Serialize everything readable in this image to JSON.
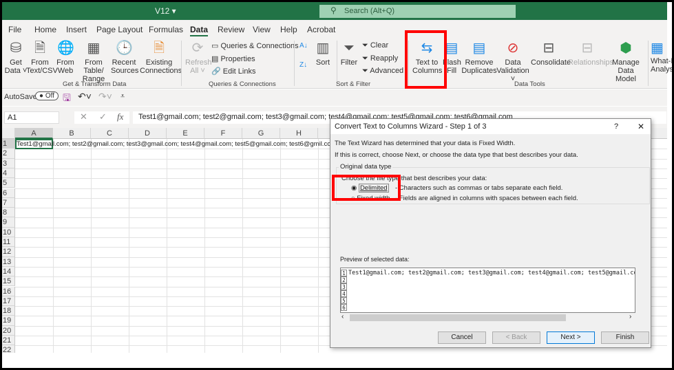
{
  "title_bar": {
    "file_name": "V12 ▾",
    "search_placeholder": "Search (Alt+Q)"
  },
  "tabs": [
    "File",
    "Home",
    "Insert",
    "Page Layout",
    "Formulas",
    "Data",
    "Review",
    "View",
    "Help",
    "Acrobat"
  ],
  "active_tab": "Data",
  "ribbon": {
    "get_transform": {
      "items": [
        [
          "Get",
          "Data ˅"
        ],
        [
          "From",
          "Text/CSV"
        ],
        [
          "From",
          "Web"
        ],
        [
          "From Table/",
          "Range"
        ],
        [
          "Recent",
          "Sources"
        ],
        [
          "Existing",
          "Connections"
        ]
      ],
      "label": "Get & Transform Data"
    },
    "queries": {
      "refresh": [
        "Refresh",
        "All ˅"
      ],
      "items": [
        "Queries & Connections",
        "Properties",
        "Edit Links"
      ],
      "label": "Queries & Connections"
    },
    "sort_filter": {
      "sort": "Sort",
      "filter": "Filter",
      "clear": "Clear",
      "reapply": "Reapply",
      "advanced": "Advanced",
      "label": "Sort & Filter"
    },
    "data_tools": {
      "items": [
        [
          "Text to",
          "Columns"
        ],
        [
          "Flash",
          "Fill"
        ],
        [
          "Remove",
          "Duplicates"
        ],
        [
          "Data",
          "Validation ˅"
        ],
        [
          "Consolidate",
          ""
        ],
        [
          "Relationships",
          ""
        ],
        [
          "Manage",
          "Data Model"
        ]
      ],
      "label": "Data Tools"
    },
    "what_if": [
      "What-If",
      "Analysis"
    ],
    "highlight_color": "#ff0000"
  },
  "qat": {
    "autosave": "AutoSave",
    "toggle": "Off"
  },
  "formula_bar": {
    "name_box": "A1",
    "fx": "fx",
    "value": "Test1@gmail.com; test2@gmail.com; test3@gmail.com; test4@gmail.com; test5@gmail.com; test6@gmail.com"
  },
  "sheet": {
    "columns": [
      "A",
      "B",
      "C",
      "D",
      "E",
      "F",
      "G",
      "H"
    ],
    "rows": [
      "1",
      "2",
      "3",
      "4",
      "5",
      "6",
      "7",
      "8",
      "9",
      "10",
      "11",
      "12",
      "13",
      "14",
      "15",
      "16",
      "17",
      "18",
      "19",
      "20",
      "21",
      "22"
    ],
    "a1": "Test1@gmail.com; test2@gmail.com; test3@gmail.com; test4@gmail.com; test5@gmail.com; test6@gmil.com"
  },
  "dialog": {
    "title": "Convert Text to Columns Wizard - Step 1 of 3",
    "help": "?",
    "close": "✕",
    "line1": "The Text Wizard has determined that your data is Fixed Width.",
    "line2": "If this is correct, choose Next, or choose the data type that best describes your data.",
    "group_label": "Original data type",
    "choose_label": "Choose the file type that best describes your data:",
    "options": [
      {
        "label": "Delimited",
        "desc": "- Characters such as commas or tabs separate each field.",
        "selected": true
      },
      {
        "label": "Fixed width",
        "desc": "- Fields are aligned in columns with spaces between each field.",
        "selected": false
      }
    ],
    "preview_label": "Preview of selected data:",
    "preview_rows": [
      "Test1@gmail.com; test2@gmail.com; test3@gmail.com; test4@gmail.com; test5@gmail.com;",
      "",
      "",
      "",
      "",
      ""
    ],
    "preview_row_numbers": [
      "1",
      "2",
      "3",
      "4",
      "5",
      "6"
    ],
    "buttons": {
      "cancel": "Cancel",
      "back": "< Back",
      "next": "Next >",
      "finish": "Finish"
    }
  }
}
